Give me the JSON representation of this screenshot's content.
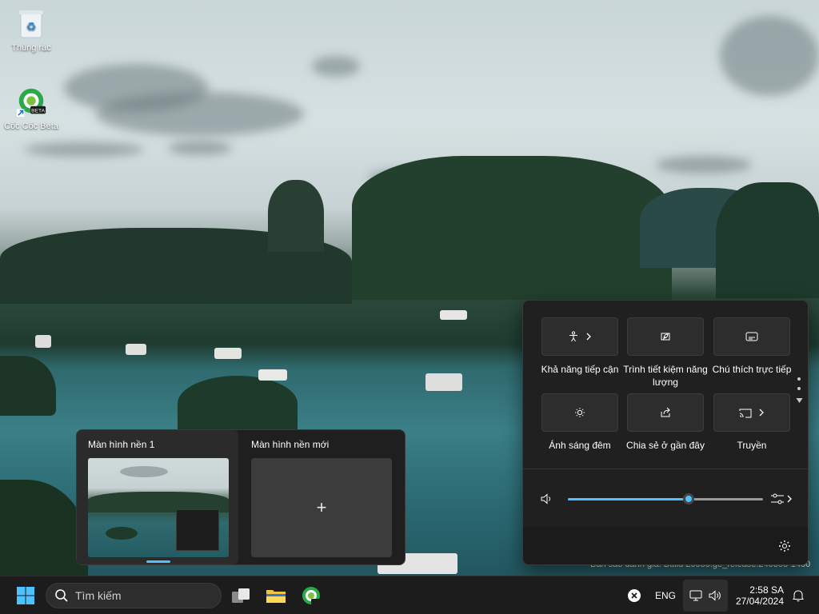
{
  "desktop_icons": [
    {
      "label": "Thùng rác",
      "icon": "recycle-bin-icon"
    },
    {
      "label": "Cốc Cốc Beta",
      "icon": "coccoc-beta-icon",
      "badge": "BETA"
    }
  ],
  "quick_settings": {
    "tiles": [
      {
        "label": "Khả năng tiếp cận",
        "icon": "accessibility-icon",
        "has_arrow": true
      },
      {
        "label": "Trình tiết kiệm năng lượng",
        "icon": "energy-saver-icon",
        "has_arrow": false
      },
      {
        "label": "Chú thích trực tiếp",
        "icon": "live-captions-icon",
        "has_arrow": false
      },
      {
        "label": "Ánh sáng đêm",
        "icon": "night-light-icon",
        "has_arrow": false
      },
      {
        "label": "Chia sẻ ở gần đây",
        "icon": "nearby-share-icon",
        "has_arrow": false
      },
      {
        "label": "Truyền",
        "icon": "cast-icon",
        "has_arrow": true
      }
    ],
    "volume_level": 0.62,
    "colors": {
      "accent": "#4cc2ff",
      "panel": "#202020",
      "tile": "#2d2d2d"
    }
  },
  "virtual_desktops": {
    "desktops": [
      {
        "title": "Màn hình nền 1",
        "active": true
      },
      {
        "title": "Màn hình nền mới",
        "active": false
      }
    ],
    "new_symbol": "+"
  },
  "taskbar": {
    "search_placeholder": "Tìm kiếm",
    "language": "ENG",
    "time": "2:58 SA",
    "date": "27/04/2024"
  },
  "watermark": "Bản sao đánh giá. Build 26080.ge_release.240308-1400"
}
